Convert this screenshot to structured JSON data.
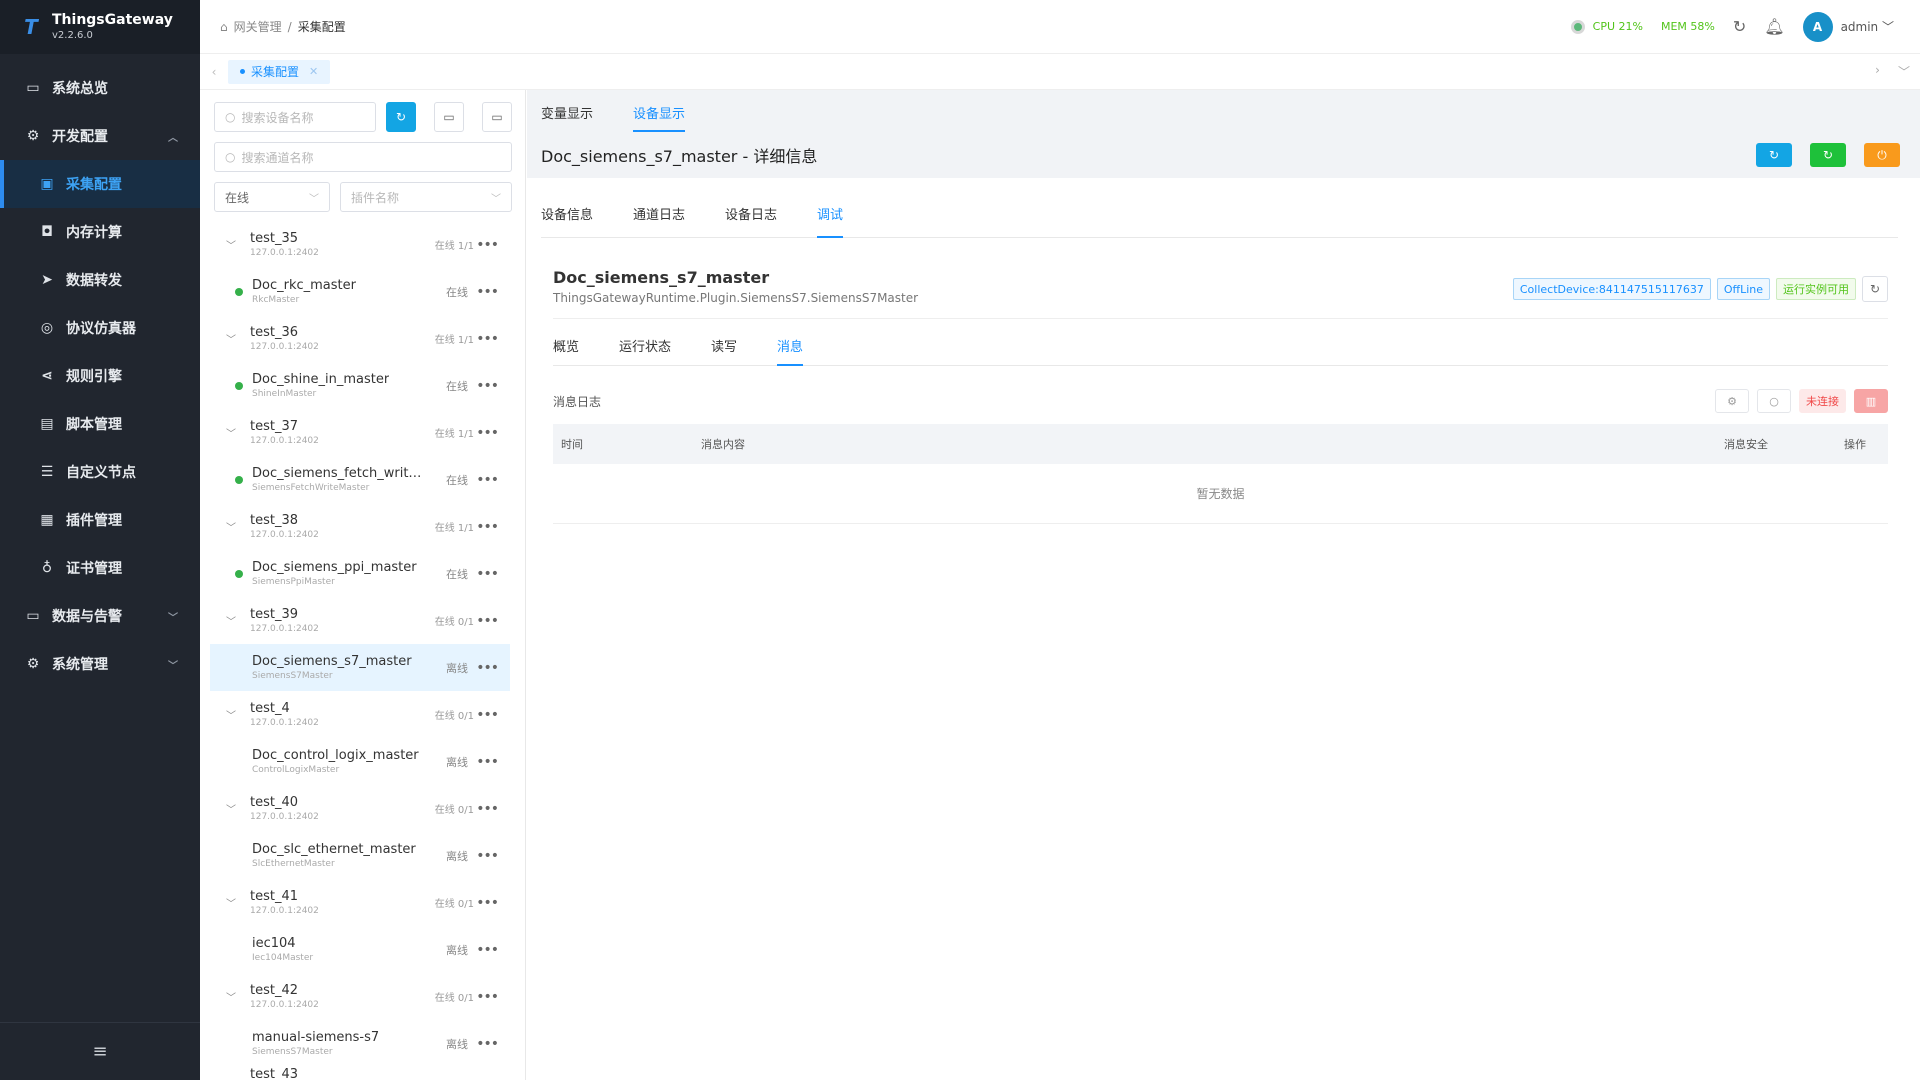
{
  "app": {
    "name": "ThingsGateway",
    "version": "v2.2.6.0"
  },
  "sidebar": {
    "items": [
      {
        "label": "系统总览"
      },
      {
        "label": "开发配置"
      },
      {
        "label": "采集配置"
      },
      {
        "label": "内存计算"
      },
      {
        "label": "数据转发"
      },
      {
        "label": "协议仿真器"
      },
      {
        "label": "规则引擎"
      },
      {
        "label": "脚本管理"
      },
      {
        "label": "自定义节点"
      },
      {
        "label": "插件管理"
      },
      {
        "label": "证书管理"
      },
      {
        "label": "数据与告警"
      },
      {
        "label": "系统管理"
      }
    ],
    "active_index": 2
  },
  "topbar": {
    "breadcrumb": [
      "网关管理",
      "采集配置"
    ],
    "cpu": "CPU 21%",
    "mem": "MEM 58%",
    "avatar_letter": "A",
    "user": "admin"
  },
  "page_tab": {
    "label": "采集配置"
  },
  "left": {
    "search_device_placeholder": "搜索设备名称",
    "search_channel_placeholder": "搜索通道名称",
    "status_filter": "在线",
    "plugin_placeholder": "插件名称",
    "groups": [
      {
        "name": "test_35",
        "ip": "127.0.0.1:2402",
        "status": "在线 1/1",
        "device": "Doc_rkc_master",
        "plugin": "RkcMaster",
        "dstatus": "在线",
        "online": true
      },
      {
        "name": "test_36",
        "ip": "127.0.0.1:2402",
        "status": "在线 1/1",
        "device": "Doc_shine_in_master",
        "plugin": "ShineInMaster",
        "dstatus": "在线",
        "online": true
      },
      {
        "name": "test_37",
        "ip": "127.0.0.1:2402",
        "status": "在线 1/1",
        "device": "Doc_siemens_fetch_write_ma...",
        "plugin": "SiemensFetchWriteMaster",
        "dstatus": "在线",
        "online": true
      },
      {
        "name": "test_38",
        "ip": "127.0.0.1:2402",
        "status": "在线 1/1",
        "device": "Doc_siemens_ppi_master",
        "plugin": "SiemensPpiMaster",
        "dstatus": "在线",
        "online": true
      },
      {
        "name": "test_39",
        "ip": "127.0.0.1:2402",
        "status": "在线 0/1",
        "device": "Doc_siemens_s7_master",
        "plugin": "SiemensS7Master",
        "dstatus": "离线",
        "online": false,
        "selected": true
      },
      {
        "name": "test_4",
        "ip": "127.0.0.1:2402",
        "status": "在线 0/1",
        "device": "Doc_control_logix_master",
        "plugin": "ControlLogixMaster",
        "dstatus": "离线",
        "online": false
      },
      {
        "name": "test_40",
        "ip": "127.0.0.1:2402",
        "status": "在线 0/1",
        "device": "Doc_slc_ethernet_master",
        "plugin": "SlcEthernetMaster",
        "dstatus": "离线",
        "online": false
      },
      {
        "name": "test_41",
        "ip": "127.0.0.1:2402",
        "status": "在线 0/1",
        "device": "iec104",
        "plugin": "Iec104Master",
        "dstatus": "离线",
        "online": false
      },
      {
        "name": "test_42",
        "ip": "127.0.0.1:2402",
        "status": "在线 0/1",
        "device": "manual-siemens-s7",
        "plugin": "SiemensS7Master",
        "dstatus": "离线",
        "online": false
      }
    ],
    "trailing_group": "test_43"
  },
  "right": {
    "top_tabs": [
      "变量显示",
      "设备显示"
    ],
    "detail_title": "Doc_siemens_s7_master - 详细信息",
    "tabs": [
      "设备信息",
      "通道日志",
      "设备日志",
      "调试"
    ],
    "device_name": "Doc_siemens_s7_master",
    "device_plugin": "ThingsGatewayRuntime.Plugin.SiemensS7.SiemensS7Master",
    "tag_collect": "CollectDevice:841147515117637",
    "tag_offline": "OffLine",
    "tag_instance": "运行实例可用",
    "sub_tabs": [
      "概览",
      "运行状态",
      "读写",
      "消息"
    ],
    "log_title": "消息日志",
    "not_connected": "未连接",
    "columns": [
      "时间",
      "消息内容",
      "消息安全",
      "操作"
    ],
    "empty": "暂无数据"
  },
  "colors": {
    "sidebar_bg": "#21262f",
    "accent": "#1890ff",
    "online": "#35b04a",
    "btn_blue": "#13a5e4",
    "btn_green": "#1ec13a",
    "btn_orange": "#f99a1c"
  }
}
